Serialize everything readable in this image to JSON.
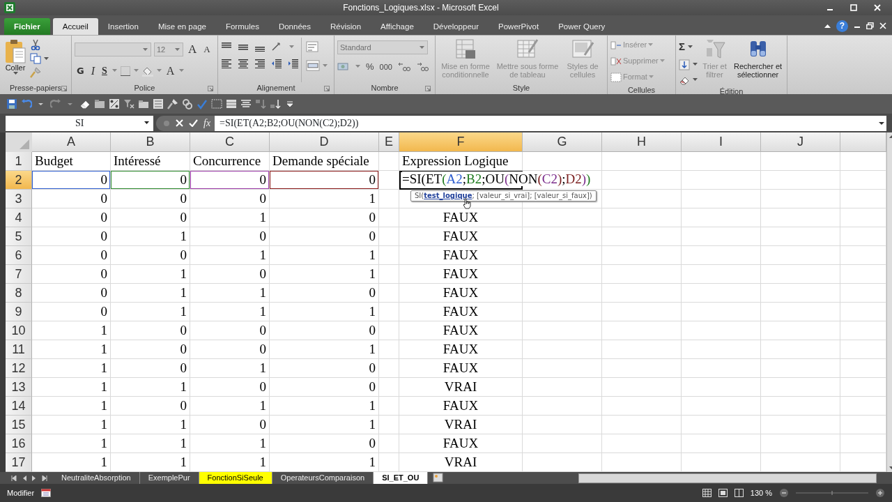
{
  "window": {
    "title": "Fonctions_Logiques.xlsx - Microsoft Excel"
  },
  "tabs": [
    {
      "label": "Fichier",
      "kind": "file",
      "selected": false
    },
    {
      "label": "Accueil",
      "kind": "tab",
      "selected": true
    },
    {
      "label": "Insertion",
      "kind": "tab",
      "selected": false
    },
    {
      "label": "Mise en page",
      "kind": "tab",
      "selected": false
    },
    {
      "label": "Formules",
      "kind": "tab",
      "selected": false
    },
    {
      "label": "Données",
      "kind": "tab",
      "selected": false
    },
    {
      "label": "Révision",
      "kind": "tab",
      "selected": false
    },
    {
      "label": "Affichage",
      "kind": "tab",
      "selected": false
    },
    {
      "label": "Développeur",
      "kind": "tab",
      "selected": false
    },
    {
      "label": "PowerPivot",
      "kind": "tab",
      "selected": false
    },
    {
      "label": "Power Query",
      "kind": "tab",
      "selected": false
    }
  ],
  "help": {
    "label": "?"
  },
  "ribbon": {
    "clipboard": {
      "label": "Presse-papiers",
      "paste": "Coller"
    },
    "font": {
      "label": "Police",
      "size": "12",
      "grow": "A",
      "shrink": "A",
      "bold": "G",
      "italic": "I",
      "underline": "S",
      "color_label": "A"
    },
    "alignment": {
      "label": "Alignement"
    },
    "number": {
      "label": "Nombre",
      "format": "Standard",
      "percent": "%",
      "thousands": "000"
    },
    "style": {
      "label": "Style",
      "commands": [
        {
          "label": "Mise en forme conditionnelle",
          "disabled": true
        },
        {
          "label": "Mettre sous forme de tableau",
          "disabled": true
        },
        {
          "label": "Styles de cellules",
          "disabled": true
        }
      ]
    },
    "cells": {
      "label": "Cellules",
      "commands": [
        {
          "label": "Insérer",
          "disabled": true
        },
        {
          "label": "Supprimer",
          "disabled": true
        },
        {
          "label": "Format",
          "disabled": true
        }
      ]
    },
    "editing": {
      "label": "Édition",
      "sum": "Σ",
      "commands": [
        {
          "label": "Trier et filtrer",
          "disabled": true
        },
        {
          "label": "Rechercher et sélectionner",
          "disabled": false
        }
      ]
    }
  },
  "formula_bar": {
    "name_box": "SI",
    "fx": "fx",
    "formula": "=SI(ET(A2;B2;OU(NON(C2);D2))"
  },
  "sheet": {
    "columns": [
      {
        "label": "A",
        "selected": false
      },
      {
        "label": "B",
        "selected": false
      },
      {
        "label": "C",
        "selected": false
      },
      {
        "label": "D",
        "selected": false
      },
      {
        "label": "E",
        "selected": false
      },
      {
        "label": "F",
        "selected": true
      },
      {
        "label": "G",
        "selected": false
      },
      {
        "label": "H",
        "selected": false
      },
      {
        "label": "I",
        "selected": false
      },
      {
        "label": "J",
        "selected": false
      }
    ],
    "rows": [
      {
        "number": "1",
        "kind": "header",
        "selected": false,
        "cells": [
          "Budget",
          "Intéressé",
          "Concurrence",
          "Demande spéciale"
        ],
        "expression": "Expression Logique"
      },
      {
        "number": "2",
        "kind": "data",
        "selected": true,
        "cells": [
          "0",
          "0",
          "0",
          "0"
        ],
        "highlights": [
          {
            "color": "#2f5fd0"
          },
          {
            "color": "#2e8b2e"
          },
          {
            "color": "#9b3aa8"
          },
          {
            "color": "#8b1a1a"
          }
        ]
      },
      {
        "number": "3",
        "kind": "data",
        "selected": false,
        "cells": [
          "0",
          "0",
          "0",
          "1"
        ]
      },
      {
        "number": "4",
        "kind": "data",
        "selected": false,
        "cells": [
          "0",
          "0",
          "1",
          "0"
        ],
        "expression": "FAUX"
      },
      {
        "number": "5",
        "kind": "data",
        "selected": false,
        "cells": [
          "0",
          "1",
          "0",
          "0"
        ],
        "expression": "FAUX"
      },
      {
        "number": "6",
        "kind": "data",
        "selected": false,
        "cells": [
          "0",
          "0",
          "1",
          "1"
        ],
        "expression": "FAUX"
      },
      {
        "number": "7",
        "kind": "data",
        "selected": false,
        "cells": [
          "0",
          "1",
          "0",
          "1"
        ],
        "expression": "FAUX"
      },
      {
        "number": "8",
        "kind": "data",
        "selected": false,
        "cells": [
          "0",
          "1",
          "1",
          "0"
        ],
        "expression": "FAUX"
      },
      {
        "number": "9",
        "kind": "data",
        "selected": false,
        "cells": [
          "0",
          "1",
          "1",
          "1"
        ],
        "expression": "FAUX"
      },
      {
        "number": "10",
        "kind": "data",
        "selected": false,
        "cells": [
          "1",
          "0",
          "0",
          "0"
        ],
        "expression": "FAUX"
      },
      {
        "number": "11",
        "kind": "data",
        "selected": false,
        "cells": [
          "1",
          "0",
          "0",
          "1"
        ],
        "expression": "FAUX"
      },
      {
        "number": "12",
        "kind": "data",
        "selected": false,
        "cells": [
          "1",
          "0",
          "1",
          "0"
        ],
        "expression": "FAUX"
      },
      {
        "number": "13",
        "kind": "data",
        "selected": false,
        "cells": [
          "1",
          "1",
          "0",
          "0"
        ],
        "expression": "VRAI"
      },
      {
        "number": "14",
        "kind": "data",
        "selected": false,
        "cells": [
          "1",
          "0",
          "1",
          "1"
        ],
        "expression": "FAUX"
      },
      {
        "number": "15",
        "kind": "data",
        "selected": false,
        "cells": [
          "1",
          "1",
          "0",
          "1"
        ],
        "expression": "VRAI"
      },
      {
        "number": "16",
        "kind": "data",
        "selected": false,
        "cells": [
          "1",
          "1",
          "1",
          "0"
        ],
        "expression": "FAUX"
      },
      {
        "number": "17",
        "kind": "data",
        "selected": false,
        "cells": [
          "1",
          "1",
          "1",
          "1"
        ],
        "expression": "VRAI"
      }
    ],
    "editor": {
      "parts": [
        {
          "text": "=SI(ET",
          "color": "#000000"
        },
        {
          "text": "(",
          "color": "#1e7a1e"
        },
        {
          "text": "A2",
          "color": "#2f5fd0"
        },
        {
          "text": ";",
          "color": "#000000"
        },
        {
          "text": "B2",
          "color": "#1e7a1e"
        },
        {
          "text": ";OU",
          "color": "#000000"
        },
        {
          "text": "(",
          "color": "#7a2a8a"
        },
        {
          "text": "NON",
          "color": "#000000"
        },
        {
          "text": "(",
          "color": "#7a1e1e"
        },
        {
          "text": "C2",
          "color": "#7a2a8a"
        },
        {
          "text": ")",
          "color": "#7a1e1e"
        },
        {
          "text": ";",
          "color": "#000000"
        },
        {
          "text": "D2",
          "color": "#7a1e1e"
        },
        {
          "text": ")",
          "color": "#7a2a8a"
        },
        {
          "text": ")",
          "color": "#1e7a1e"
        }
      ],
      "tooltip": "SI(**test_logique**; [valeur_si_vrai]; [valeur_si_faux])"
    }
  },
  "sheet_tabs": [
    {
      "label": "NeutraliteAbsorption",
      "selected": false
    },
    {
      "label": "ExemplePur",
      "selected": false
    },
    {
      "label": "FonctionSiSeule",
      "selected": false,
      "color": "#ffff00"
    },
    {
      "label": "OperateursComparaison",
      "selected": false
    },
    {
      "label": "SI_ET_OU",
      "selected": true
    }
  ],
  "status_bar": {
    "mode": "Modifier",
    "zoom": "130 %"
  }
}
